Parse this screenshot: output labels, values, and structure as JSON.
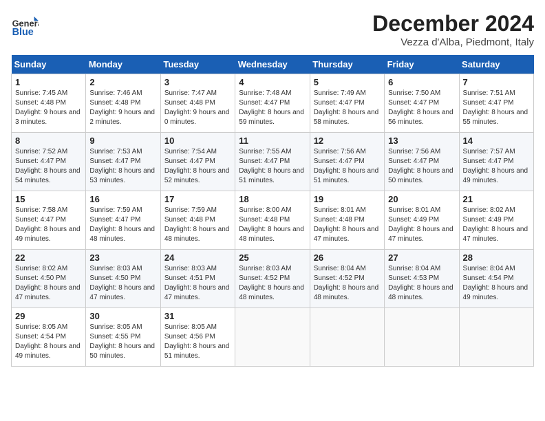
{
  "header": {
    "logo_general": "General",
    "logo_blue": "Blue",
    "month_title": "December 2024",
    "location": "Vezza d'Alba, Piedmont, Italy"
  },
  "weekdays": [
    "Sunday",
    "Monday",
    "Tuesday",
    "Wednesday",
    "Thursday",
    "Friday",
    "Saturday"
  ],
  "weeks": [
    [
      {
        "day": "1",
        "sunrise": "7:45 AM",
        "sunset": "4:48 PM",
        "daylight": "9 hours and 3 minutes."
      },
      {
        "day": "2",
        "sunrise": "7:46 AM",
        "sunset": "4:48 PM",
        "daylight": "9 hours and 2 minutes."
      },
      {
        "day": "3",
        "sunrise": "7:47 AM",
        "sunset": "4:48 PM",
        "daylight": "9 hours and 0 minutes."
      },
      {
        "day": "4",
        "sunrise": "7:48 AM",
        "sunset": "4:47 PM",
        "daylight": "8 hours and 59 minutes."
      },
      {
        "day": "5",
        "sunrise": "7:49 AM",
        "sunset": "4:47 PM",
        "daylight": "8 hours and 58 minutes."
      },
      {
        "day": "6",
        "sunrise": "7:50 AM",
        "sunset": "4:47 PM",
        "daylight": "8 hours and 56 minutes."
      },
      {
        "day": "7",
        "sunrise": "7:51 AM",
        "sunset": "4:47 PM",
        "daylight": "8 hours and 55 minutes."
      }
    ],
    [
      {
        "day": "8",
        "sunrise": "7:52 AM",
        "sunset": "4:47 PM",
        "daylight": "8 hours and 54 minutes."
      },
      {
        "day": "9",
        "sunrise": "7:53 AM",
        "sunset": "4:47 PM",
        "daylight": "8 hours and 53 minutes."
      },
      {
        "day": "10",
        "sunrise": "7:54 AM",
        "sunset": "4:47 PM",
        "daylight": "8 hours and 52 minutes."
      },
      {
        "day": "11",
        "sunrise": "7:55 AM",
        "sunset": "4:47 PM",
        "daylight": "8 hours and 51 minutes."
      },
      {
        "day": "12",
        "sunrise": "7:56 AM",
        "sunset": "4:47 PM",
        "daylight": "8 hours and 51 minutes."
      },
      {
        "day": "13",
        "sunrise": "7:56 AM",
        "sunset": "4:47 PM",
        "daylight": "8 hours and 50 minutes."
      },
      {
        "day": "14",
        "sunrise": "7:57 AM",
        "sunset": "4:47 PM",
        "daylight": "8 hours and 49 minutes."
      }
    ],
    [
      {
        "day": "15",
        "sunrise": "7:58 AM",
        "sunset": "4:47 PM",
        "daylight": "8 hours and 49 minutes."
      },
      {
        "day": "16",
        "sunrise": "7:59 AM",
        "sunset": "4:47 PM",
        "daylight": "8 hours and 48 minutes."
      },
      {
        "day": "17",
        "sunrise": "7:59 AM",
        "sunset": "4:48 PM",
        "daylight": "8 hours and 48 minutes."
      },
      {
        "day": "18",
        "sunrise": "8:00 AM",
        "sunset": "4:48 PM",
        "daylight": "8 hours and 48 minutes."
      },
      {
        "day": "19",
        "sunrise": "8:01 AM",
        "sunset": "4:48 PM",
        "daylight": "8 hours and 47 minutes."
      },
      {
        "day": "20",
        "sunrise": "8:01 AM",
        "sunset": "4:49 PM",
        "daylight": "8 hours and 47 minutes."
      },
      {
        "day": "21",
        "sunrise": "8:02 AM",
        "sunset": "4:49 PM",
        "daylight": "8 hours and 47 minutes."
      }
    ],
    [
      {
        "day": "22",
        "sunrise": "8:02 AM",
        "sunset": "4:50 PM",
        "daylight": "8 hours and 47 minutes."
      },
      {
        "day": "23",
        "sunrise": "8:03 AM",
        "sunset": "4:50 PM",
        "daylight": "8 hours and 47 minutes."
      },
      {
        "day": "24",
        "sunrise": "8:03 AM",
        "sunset": "4:51 PM",
        "daylight": "8 hours and 47 minutes."
      },
      {
        "day": "25",
        "sunrise": "8:03 AM",
        "sunset": "4:52 PM",
        "daylight": "8 hours and 48 minutes."
      },
      {
        "day": "26",
        "sunrise": "8:04 AM",
        "sunset": "4:52 PM",
        "daylight": "8 hours and 48 minutes."
      },
      {
        "day": "27",
        "sunrise": "8:04 AM",
        "sunset": "4:53 PM",
        "daylight": "8 hours and 48 minutes."
      },
      {
        "day": "28",
        "sunrise": "8:04 AM",
        "sunset": "4:54 PM",
        "daylight": "8 hours and 49 minutes."
      }
    ],
    [
      {
        "day": "29",
        "sunrise": "8:05 AM",
        "sunset": "4:54 PM",
        "daylight": "8 hours and 49 minutes."
      },
      {
        "day": "30",
        "sunrise": "8:05 AM",
        "sunset": "4:55 PM",
        "daylight": "8 hours and 50 minutes."
      },
      {
        "day": "31",
        "sunrise": "8:05 AM",
        "sunset": "4:56 PM",
        "daylight": "8 hours and 51 minutes."
      },
      null,
      null,
      null,
      null
    ]
  ]
}
